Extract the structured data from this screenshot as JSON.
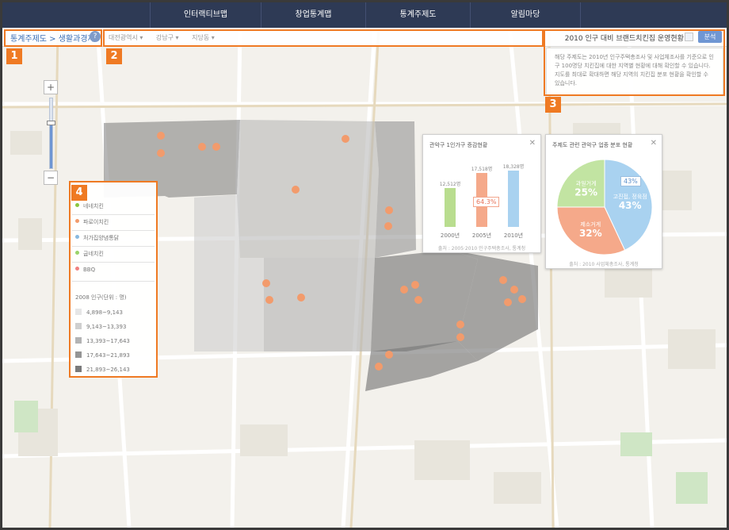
{
  "nav": {
    "tabs": [
      "인터랙티브맵",
      "창업통계맵",
      "통계주제도",
      "알림마당"
    ]
  },
  "toolbar": {
    "breadcrumb": "통계주제도 > 생활과경제",
    "help": "?",
    "regions": [
      "대전광역시 ▾",
      "강남구 ▾",
      "지당동 ▾"
    ],
    "title": "2010 인구 대비 브랜드치킨집 운영현황",
    "analyze_label": "분석"
  },
  "description": "해당 주제도는 2010년 인구주택총조사 및 사업체조사를 기준으로 인구 100명당 치킨집에 대한 지역별 현황에 대해 확인할 수 있습니다. 지도를 최대로 확대하면 해당 지역의 치킨집 분포 현황을 확인할 수 있습니다.",
  "callouts": [
    "1",
    "2",
    "3",
    "4"
  ],
  "zoom": {
    "plus": "+",
    "minus": "−",
    "level": 0.65
  },
  "legend": {
    "brands": [
      {
        "label": "네네치킨",
        "color": "#8cc63f"
      },
      {
        "label": "파로이치킨",
        "color": "#f29b6c"
      },
      {
        "label": "처가집양념통닭",
        "color": "#88b9e0"
      },
      {
        "label": "굽네치킨",
        "color": "#9ad36a"
      },
      {
        "label": "BBQ",
        "color": "#f08080"
      }
    ],
    "heading": "2008 인구(단위 : 명)",
    "classes": [
      {
        "label": "4,898~9,143",
        "color": "#e6e6e6"
      },
      {
        "label": "9,143~13,393",
        "color": "#cfcfcf"
      },
      {
        "label": "13,393~17,643",
        "color": "#b3b3b3"
      },
      {
        "label": "17,643~21,893",
        "color": "#959595"
      },
      {
        "label": "21,893~26,143",
        "color": "#7a7a7a"
      }
    ]
  },
  "popup1": {
    "title": "관악구 1인가구 증감현황",
    "source": "출처 : 2005·2010 인구주택총조사, 통계청",
    "pct_label": "64.3%"
  },
  "popup2": {
    "title": "주제도 관련 관악구 업종 분포 현황",
    "source": "출처 : 2010 사업체총조사, 통계청",
    "pct_tag": "43%"
  },
  "chart_data": [
    {
      "type": "bar",
      "title": "관악구 1인가구 증감현황",
      "categories": [
        "2000년",
        "2005년",
        "2010년"
      ],
      "values": [
        12512,
        17518,
        18328
      ],
      "value_labels": [
        "12,512명",
        "17,518명",
        "18,328명"
      ],
      "colors": [
        "#b9dd8f",
        "#f5a98a",
        "#a9d2f0"
      ],
      "annotation": "64.3%",
      "ylim": [
        0,
        20000
      ]
    },
    {
      "type": "pie",
      "title": "주제도 관련 관악구 업종 분포 현황",
      "slices": [
        {
          "label": "고진접, 정육점",
          "value": 43,
          "text": "43%",
          "color": "#a9d2f0"
        },
        {
          "label": "제소거게",
          "value": 32,
          "text": "32%",
          "color": "#f5a98a"
        },
        {
          "label": "과일거게",
          "value": 25,
          "text": "25%",
          "color": "#c2e4a2"
        }
      ]
    }
  ]
}
